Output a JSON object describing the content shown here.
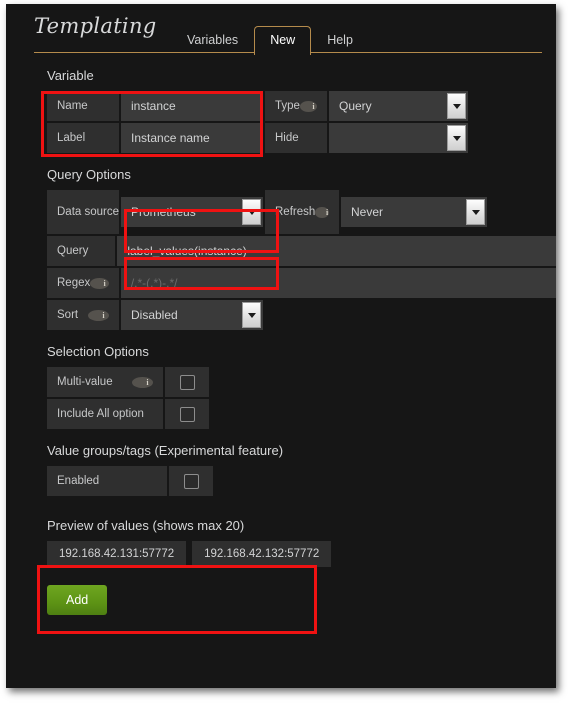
{
  "header": {
    "title": "Templating",
    "tabs": [
      {
        "label": "Variables",
        "active": false
      },
      {
        "label": "New",
        "active": true
      },
      {
        "label": "Help",
        "active": false
      }
    ]
  },
  "variable": {
    "section_title": "Variable",
    "name_label": "Name",
    "name_value": "instance",
    "label_label": "Label",
    "label_value": "Instance name",
    "type_label": "Type",
    "type_value": "Query",
    "hide_label": "Hide",
    "hide_value": "",
    "info_glyph": "i"
  },
  "query_options": {
    "section_title": "Query Options",
    "datasource_label": "Data source",
    "datasource_value": "Prometheus",
    "refresh_label": "Refresh",
    "refresh_value": "Never",
    "query_label": "Query",
    "query_value": "label_values(instance)",
    "regex_label": "Regex",
    "regex_placeholder": "/.*-(.*)-.*/",
    "sort_label": "Sort",
    "sort_value": "Disabled"
  },
  "selection_options": {
    "section_title": "Selection Options",
    "multi_value_label": "Multi-value",
    "multi_value_checked": false,
    "include_all_label": "Include All option",
    "include_all_checked": false
  },
  "value_groups": {
    "section_title": "Value groups/tags (Experimental feature)",
    "enabled_label": "Enabled",
    "enabled_checked": false
  },
  "preview": {
    "section_title": "Preview of values (shows max 20)",
    "values": [
      "192.168.42.131:57772",
      "192.168.42.132:57772"
    ]
  },
  "actions": {
    "add_label": "Add"
  },
  "colors": {
    "accent": "#b58b4c",
    "annotation": "#ef1212",
    "add_button": "#5d9315",
    "panel_bg": "#161616",
    "field_bg": "#3a3a3a",
    "label_bg": "#2f2f2f"
  }
}
